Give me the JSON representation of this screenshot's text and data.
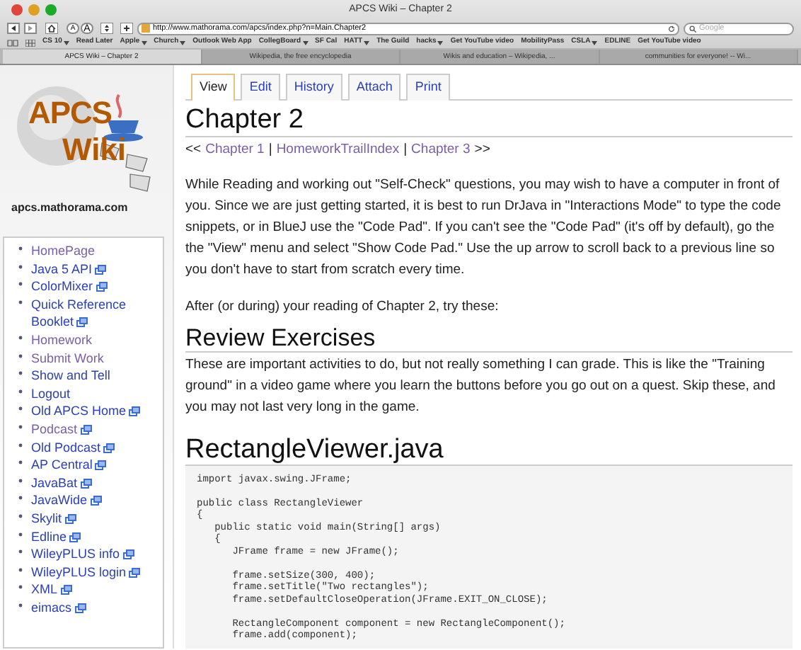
{
  "window": {
    "title": "APCS Wiki – Chapter 2"
  },
  "toolbar": {
    "address": "http://www.mathorama.com/apcs/index.php?n=Main.Chapter2",
    "search_placeholder": "Google",
    "font_buttons": [
      "A",
      "A"
    ]
  },
  "bookmarks": [
    {
      "label": "CS 10",
      "menu": true
    },
    {
      "label": "Read Later",
      "menu": false
    },
    {
      "label": "Apple",
      "menu": true
    },
    {
      "label": "Church",
      "menu": true
    },
    {
      "label": "Outlook Web App",
      "menu": false
    },
    {
      "label": "CollegBoard",
      "menu": true
    },
    {
      "label": "SF Cal",
      "menu": false
    },
    {
      "label": "HATT",
      "menu": true
    },
    {
      "label": "The Guild",
      "menu": false
    },
    {
      "label": "hacks",
      "menu": true
    },
    {
      "label": "Get YouTube video",
      "menu": false
    },
    {
      "label": "MobilityPass",
      "menu": false
    },
    {
      "label": "CSLA",
      "menu": true
    },
    {
      "label": "EDLINE",
      "menu": false
    },
    {
      "label": "Get YouTube video",
      "menu": false
    }
  ],
  "browser_tabs": [
    {
      "label": "APCS Wiki – Chapter 2",
      "selected": true
    },
    {
      "label": "Wikipedia, the free encyclopedia",
      "selected": false
    },
    {
      "label": "Wikis and education – Wikipedia, ...",
      "selected": false
    },
    {
      "label": "communities for everyone! -- Wi...",
      "selected": false
    }
  ],
  "logo": {
    "line1": "APCS",
    "line2": "Wiki",
    "domain": "apcs.mathorama.com"
  },
  "sidebar": {
    "items": [
      {
        "label": "HomePage",
        "visited": true,
        "external": false
      },
      {
        "label": "Java 5 API",
        "visited": false,
        "external": true
      },
      {
        "label": "ColorMixer",
        "visited": false,
        "external": true
      },
      {
        "label": "Quick Reference Booklet",
        "visited": false,
        "external": true
      },
      {
        "label": "Homework",
        "visited": true,
        "external": false
      },
      {
        "label": "Submit Work",
        "visited": true,
        "external": false
      },
      {
        "label": "Show and Tell",
        "visited": false,
        "external": false
      },
      {
        "label": "Logout",
        "visited": false,
        "external": false
      },
      {
        "label": "Old APCS Home",
        "visited": false,
        "external": true
      },
      {
        "label": "Podcast",
        "visited": true,
        "external": true
      },
      {
        "label": "Old Podcast",
        "visited": false,
        "external": true
      },
      {
        "label": "AP Central",
        "visited": false,
        "external": true
      },
      {
        "label": "JavaBat",
        "visited": false,
        "external": true
      },
      {
        "label": "JavaWide",
        "visited": false,
        "external": true
      },
      {
        "label": "Skylit",
        "visited": false,
        "external": true
      },
      {
        "label": "Edline",
        "visited": false,
        "external": true
      },
      {
        "label": "WileyPLUS info",
        "visited": false,
        "external": true
      },
      {
        "label": "WileyPLUS login",
        "visited": false,
        "external": true
      },
      {
        "label": "XML",
        "visited": false,
        "external": true
      },
      {
        "label": "eimacs",
        "visited": false,
        "external": true
      }
    ]
  },
  "page_tabs": [
    {
      "label": "View",
      "selected": true
    },
    {
      "label": "Edit",
      "selected": false
    },
    {
      "label": "History",
      "selected": false
    },
    {
      "label": "Attach",
      "selected": false
    },
    {
      "label": "Print",
      "selected": false
    }
  ],
  "title": "Chapter 2",
  "breadcrumb": [
    {
      "kind": "text",
      "text": "<<"
    },
    {
      "kind": "link",
      "text": "Chapter 1",
      "visited": true
    },
    {
      "kind": "text",
      "text": "|"
    },
    {
      "kind": "link",
      "text": "HomeworkTrailIndex",
      "visited": true
    },
    {
      "kind": "text",
      "text": "|"
    },
    {
      "kind": "link",
      "text": "Chapter 3",
      "visited": true
    },
    {
      "kind": "text",
      "text": ">>"
    }
  ],
  "intro": [
    "While Reading and working out \"Self-Check\" questions, you may wish to have a computer in front of you. Since we are just getting started, it is best to run DrJava in \"Interactions Mode\" to type the code snippets, or in BlueJ use the \"Code Pad\". If you can't see the \"Code Pad\" (it's off by default), go the the \"View\" menu and select \"Show Code Pad.\" Use the up arrow to scroll back to a previous line so you don't have to start from scratch every time.",
    "After (or during) your reading of Chapter 2, try these:"
  ],
  "review": {
    "heading": "Review Exercises",
    "text": "These are important activities to do, but not really something I can grade. This is like the \"Training ground\" in a video game where you learn the buttons before you go out on a quest. Skip these, and you may not last very long in the game."
  },
  "code_section": {
    "heading": "RectangleViewer.java",
    "blocks": [
      [
        "import javax.swing.JFrame;"
      ],
      [
        "public class RectangleViewer",
        "{",
        "   public static void main(String[] args)",
        "   {",
        "      JFrame frame = new JFrame();"
      ],
      [
        "      frame.setSize(300, 400);",
        "      frame.setTitle(\"Two rectangles\");",
        "      frame.setDefaultCloseOperation(JFrame.EXIT_ON_CLOSE);"
      ],
      [
        "      RectangleComponent component = new RectangleComponent();",
        "      frame.add(component);"
      ]
    ]
  }
}
